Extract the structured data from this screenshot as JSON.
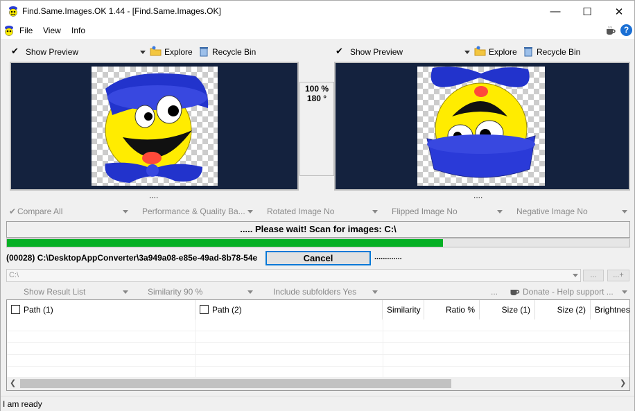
{
  "window": {
    "title": "Find.Same.Images.OK 1.44 - [Find.Same.Images.OK]",
    "minimize": "—",
    "maximize": "☐",
    "close": "✕"
  },
  "menu": {
    "file": "File",
    "view": "View",
    "info": "Info",
    "coffee_icon": "coffee-cup-icon",
    "help_icon": "?"
  },
  "left_pane": {
    "check": "✔",
    "show_preview": "Show Preview",
    "explore": "Explore",
    "recycle_bin": "Recycle Bin",
    "dots": "...."
  },
  "right_pane": {
    "check": "✔",
    "show_preview": "Show Preview",
    "explore": "Explore",
    "recycle_bin": "Recycle Bin",
    "dots": "...."
  },
  "center_info": {
    "zoom": "100 %",
    "rotation": "180 °"
  },
  "options_bar": {
    "check": "✔",
    "compare_all": "Compare All",
    "performance": "Performance & Quality Ba...",
    "rotated": "Rotated Image No",
    "flipped": "Flipped Image No",
    "negative": "Negative Image No"
  },
  "scan": {
    "status": "..... Please wait! Scan for images: C:\\",
    "progress": 0.7,
    "current_path": "(00028) C:\\DesktopAppConverter\\3a949a08-e85e-49ad-8b78-54e",
    "cancel": "Cancel",
    "dots": "............."
  },
  "folder": {
    "path": "C:\\",
    "browse": "...",
    "add": "...+"
  },
  "result_bar": {
    "show_result_list": "Show Result List",
    "similarity": "Similarity 90 %",
    "include_subfolders": "Include subfolders Yes",
    "more": "...",
    "donate": "Donate - Help support ..."
  },
  "columns": {
    "path1": "Path (1)",
    "path2": "Path (2)",
    "similarity": "Similarity",
    "ratio": "Ratio %",
    "size1": "Size (1)",
    "size2": "Size (2)",
    "brightness": "Brightness"
  },
  "statusbar": {
    "text": "I am ready"
  },
  "colors": {
    "preview_bg": "#14223e",
    "progress": "#06b025",
    "accent": "#0078d7"
  }
}
